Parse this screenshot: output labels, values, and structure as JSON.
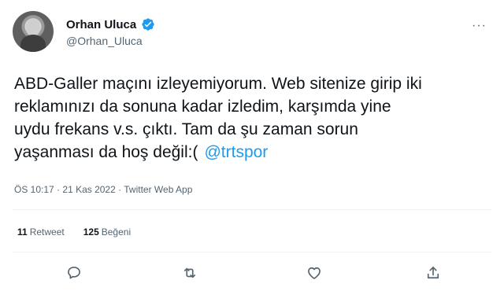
{
  "author": {
    "display_name": "Orhan Uluca",
    "handle": "@Orhan_Uluca",
    "verified": true
  },
  "tweet": {
    "lines": [
      "ABD-Galler maçını izleyemiyorum. Web sitenize girip iki",
      "reklamınızı da sonuna kadar izledim, karşımda yine",
      "uydu frekans v.s. çıktı.  Tam da şu zaman sorun",
      "yaşanması da hoş değil:("
    ],
    "mention": "@trtspor"
  },
  "meta": {
    "time": "ÖS 10:17",
    "sep1": "·",
    "date": "21 Kas 2022",
    "sep2": "·",
    "source": "Twitter Web App"
  },
  "stats": {
    "retweets_count": "11",
    "retweets_label": "Retweet",
    "likes_count": "125",
    "likes_label": "Beğeni"
  },
  "actions": {
    "reply_icon": "reply-icon",
    "retweet_icon": "retweet-icon",
    "like_icon": "heart-icon",
    "share_icon": "share-icon"
  },
  "colors": {
    "accent": "#1d9bf0",
    "text": "#0f1419",
    "secondary": "#536471",
    "divider": "#eff3f4"
  }
}
